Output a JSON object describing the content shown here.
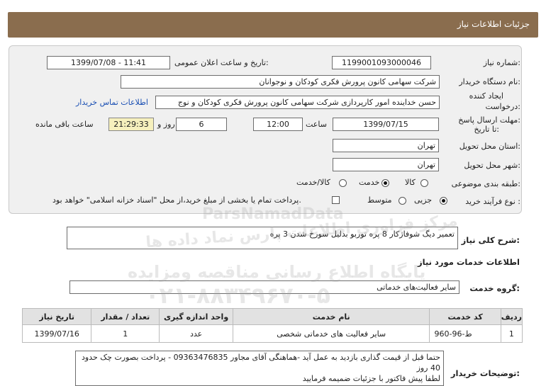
{
  "page_title": "جزئیات اطلاعات نیاز",
  "fields": {
    "need_number_label": "شماره نیاز:",
    "need_number": "1199001093000046",
    "announce_label": "تاریخ و ساعت اعلان عمومی:",
    "announce_value": "1399/07/08 - 11:41",
    "buyer_label": "نام دستگاه خریدار:",
    "buyer_value": "شرکت سهامی کانون پرورش فکری کودکان و نوجوانان",
    "creator_label_1": "ایجاد کننده",
    "creator_label_2": "درخواست:",
    "creator_value": "حسن خداینده امور کارپردازی  شرکت سهامی کانون پرورش فکری کودکان و نوج",
    "contact_link": "اطلاعات تماس خریدار",
    "deadline_label_1": "مهلت ارسال پاسخ:",
    "deadline_label_2": "تا تاریخ:",
    "deadline_date": "1399/07/15",
    "time_label": "ساعت",
    "deadline_time": "12:00",
    "days_value": "6",
    "days_label": "روز و",
    "remaining_time": "21:29:33",
    "remaining_label": "ساعت باقی مانده",
    "province_label": "استان محل تحویل:",
    "province_value": "تهران",
    "city_label": "شهر محل تحویل:",
    "city_value": "تهران",
    "category_label": "طبقه بندی موضوعی:",
    "category_options": [
      "کالا",
      "خدمت",
      "کالا/خدمت"
    ],
    "category_selected": "خدمت",
    "process_label": "نوع فرآیند خرید :",
    "process_options": [
      "جزیی",
      "متوسط"
    ],
    "process_selected": "جزیی",
    "treasury_note": "پرداخت تمام یا بخشی از مبلغ خرید،از محل \"اسناد خزانه اسلامی\" خواهد بود."
  },
  "summary_label": "شرح کلی نیاز:",
  "summary_value": "تعمیر دیگ شوفاژکار 8 پره توربو بدلیل سورخ شدن 3 پره",
  "services_heading": "اطلاعات خدمات مورد نیاز",
  "service_group_label": "گروه خدمت:",
  "service_group_value": "سایر فعالیت‌های خدماتی",
  "table": {
    "headers": [
      "ردیف",
      "کد خدمت",
      "نام خدمت",
      "واحد اندازه گیری",
      "تعداد / مقدار",
      "تاریخ نیاز"
    ],
    "rows": [
      [
        "1",
        "ط-96-960",
        "سایر فعالیت های خدماتی شخصی",
        "عدد",
        "1",
        "1399/07/16"
      ]
    ]
  },
  "buyer_notes_label": "توضیحات خریدار:",
  "buyer_notes_lines": [
    "حتما قبل از قیمت گذاری بازدید به عمل آید -هماهنگی آقای مجاور 09363476835 -  پرداخت بصورت چک حدود 40 روز",
    "لطفا پیش فاکتور با جزئیات ضمیمه فرمایید"
  ],
  "watermark": {
    "brand": "ParsNamadData",
    "line1": "مرکز فراوری اطلاعات پارس نماد داده ها",
    "line2": "پایگاه اطلاع رسانی مناقصه ومزایده",
    "phone": "۰۲۱-۸۸۳۴۹۶۷۰-۵"
  }
}
